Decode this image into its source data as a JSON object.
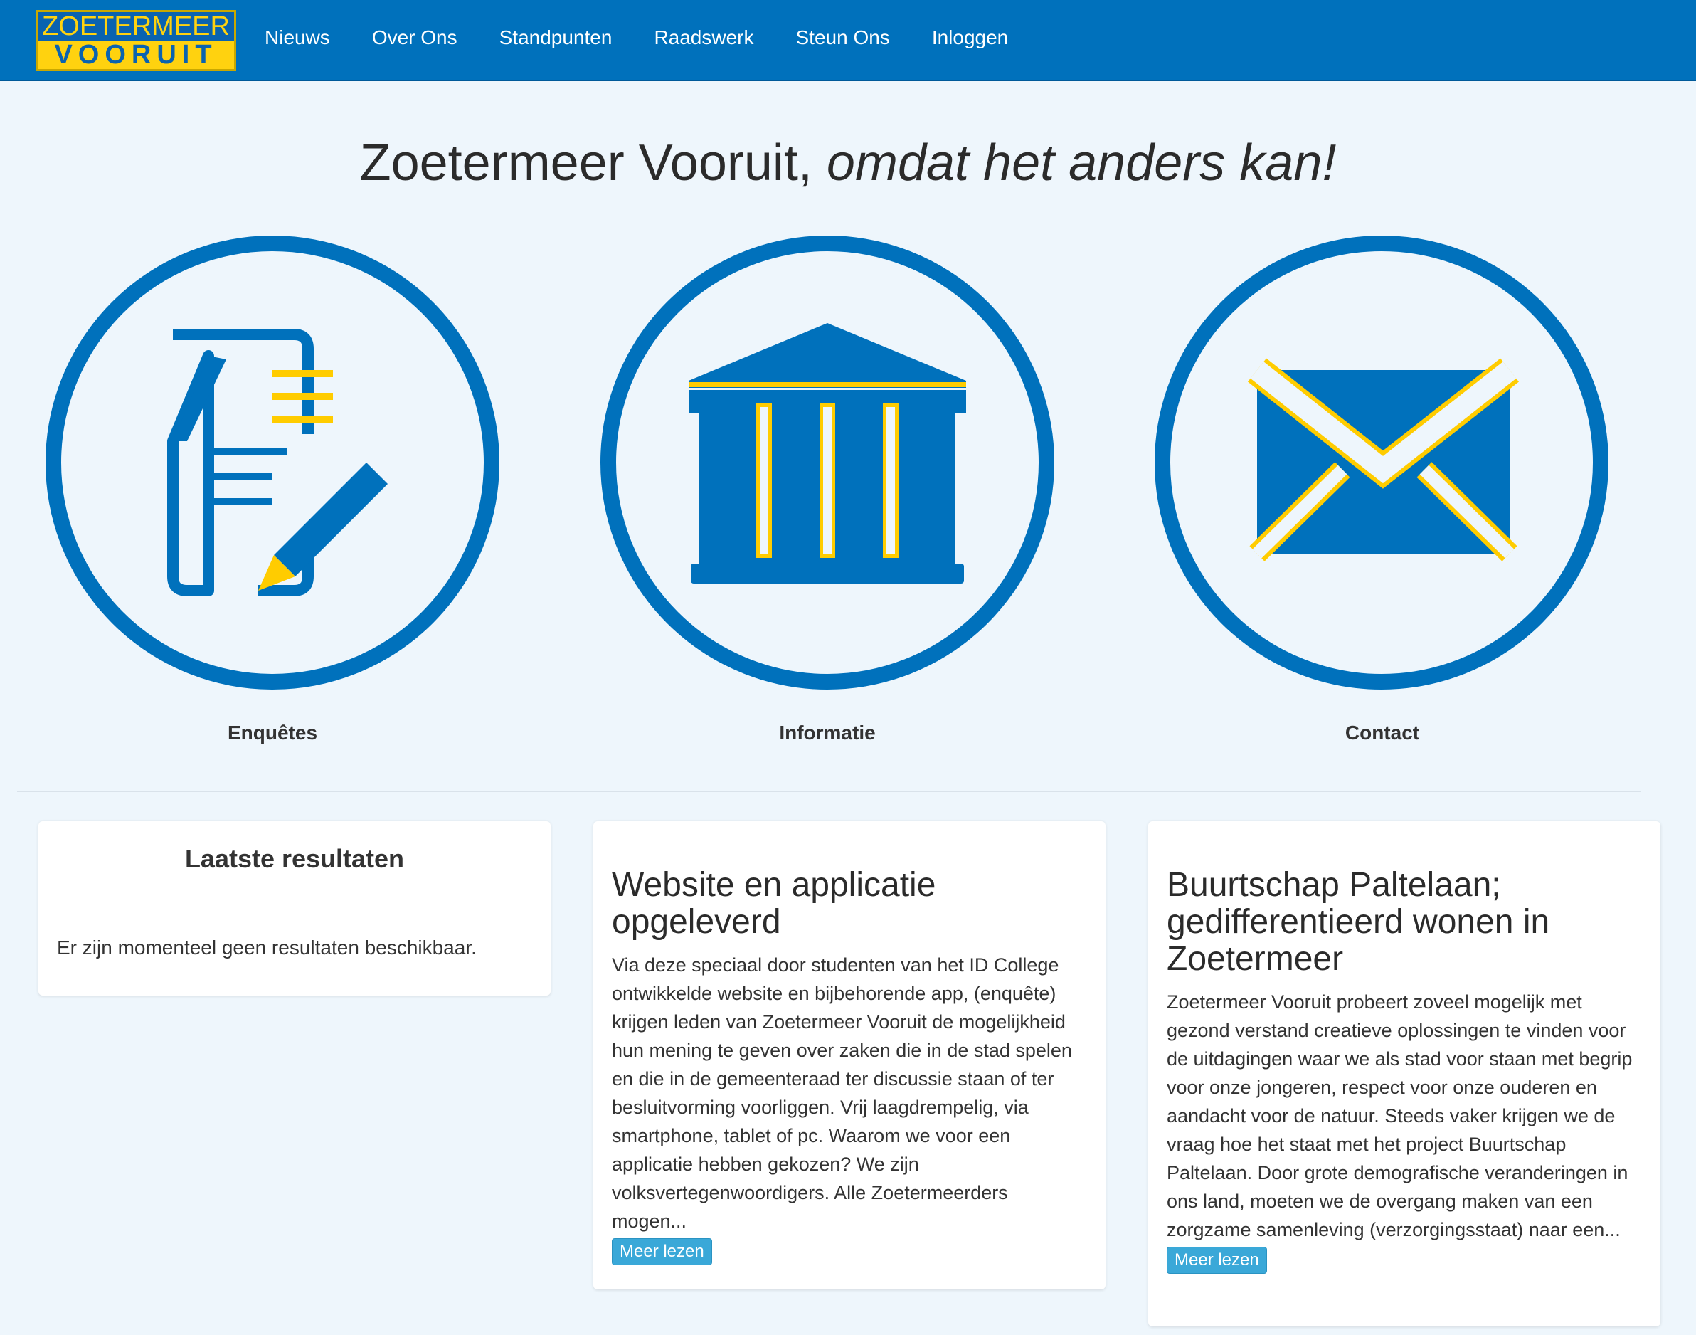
{
  "nav": {
    "logo_top": "ZOETERMEER",
    "logo_bottom": "VOORUIT",
    "links": [
      "Nieuws",
      "Over Ons",
      "Standpunten",
      "Raadswerk",
      "Steun Ons",
      "Inloggen"
    ]
  },
  "hero": {
    "title_main": "Zoetermeer Vooruit,",
    "title_italic": "omdat het anders kan!"
  },
  "features": [
    {
      "label": "Enquêtes",
      "icon": "survey-icon"
    },
    {
      "label": "Informatie",
      "icon": "government-building-icon"
    },
    {
      "label": "Contact",
      "icon": "envelope-icon"
    }
  ],
  "results": {
    "title": "Laatste resultaten",
    "empty_text": "Er zijn momenteel geen resultaten beschikbaar."
  },
  "articles": [
    {
      "title": "Website en applicatie opgeleverd",
      "body": "Via deze speciaal door studenten van het ID College ontwikkelde website en bijbehorende app, (enquête) krijgen leden van Zoetermeer Vooruit de mogelijkheid hun mening te geven over zaken die in de stad spelen en die in de gemeenteraad ter discussie staan of ter besluitvorming voorliggen. Vrij laagdrempelig, via smartphone, tablet of pc. Waarom we voor een applicatie hebben gekozen? We zijn volksvertegenwoordigers. Alle Zoetermeerders mogen...",
      "button": "Meer lezen"
    },
    {
      "title": "Buurtschap Paltelaan; gedifferentieerd wonen in Zoetermeer",
      "body": "Zoetermeer Vooruit probeert zoveel mogelijk met gezond verstand creatieve oplossingen te vinden voor de uitdagingen waar we als stad voor staan met begrip voor onze jongeren, respect voor onze ouderen en aandacht voor de natuur. Steeds vaker krijgen we de vraag hoe het staat met het project Buurtschap Paltelaan. Door grote demografische veranderingen in ons land, moeten we de overgang maken van een zorgzame samenleving (verzorgingsstaat) naar een...",
      "button": "Meer lezen"
    }
  ],
  "colors": {
    "primary": "#0071bc",
    "accent": "#ffd20f",
    "background": "#eef6fc",
    "button": "#3aa8d8"
  }
}
